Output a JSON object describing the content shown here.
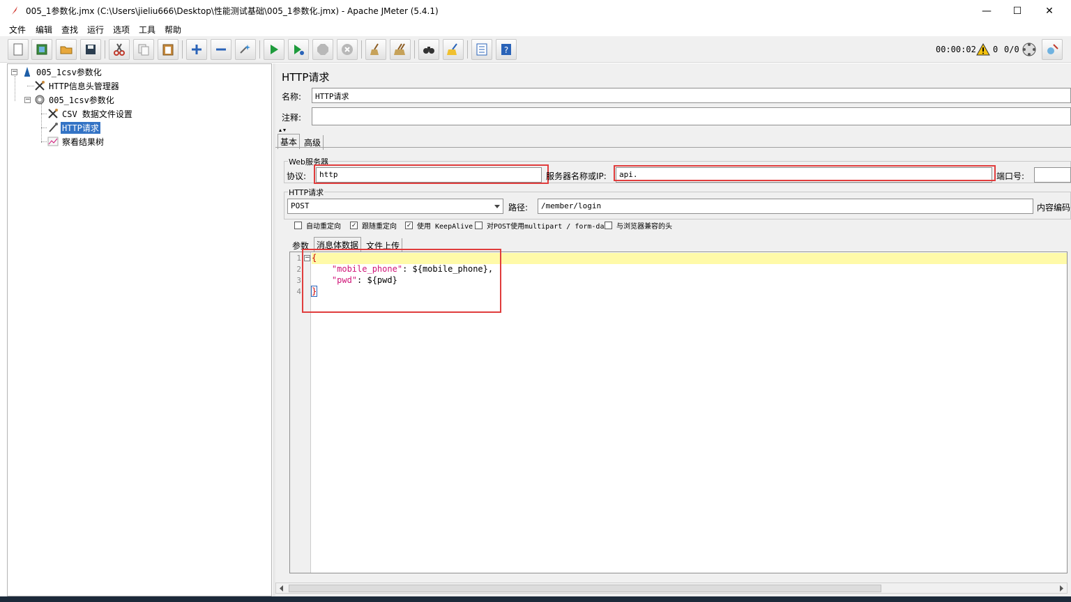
{
  "window": {
    "title": "005_1参数化.jmx (C:\\Users\\jieliu666\\Desktop\\性能测试基础\\005_1参数化.jmx) - Apache JMeter (5.4.1)",
    "minimize": "—",
    "maximize": "☐",
    "close": "✕"
  },
  "menu": [
    "文件",
    "编辑",
    "查找",
    "运行",
    "选项",
    "工具",
    "帮助"
  ],
  "toolbar": {
    "timer": "00:00:02",
    "warnings": "0",
    "threads": "0/0"
  },
  "tree": {
    "root": "005_1csv参数化",
    "header_manager": "HTTP信息头管理器",
    "thread_group": "005_1csv参数化",
    "csv_config": "CSV 数据文件设置",
    "http_request": "HTTP请求",
    "result_tree": "察看结果树"
  },
  "panel": {
    "heading": "HTTP请求",
    "name_label": "名称:",
    "name_value": "HTTP请求",
    "comment_label": "注释:",
    "comment_value": "",
    "tab_basic": "基本",
    "tab_advanced": "高级",
    "web_server_title": "Web服务器",
    "protocol_label": "协议:",
    "protocol_value": "http",
    "server_label": "服务器名称或IP:",
    "server_value": "api.",
    "port_label": "端口号:",
    "port_value": "",
    "http_request_title": "HTTP请求",
    "method_value": "POST",
    "path_label": "路径:",
    "path_value": "/member/login",
    "encoding_label": "内容编码",
    "checkboxes": [
      {
        "label": "自动重定向",
        "checked": false
      },
      {
        "label": "跟随重定向",
        "checked": true
      },
      {
        "label": "使用 KeepAlive",
        "checked": true
      },
      {
        "label": "对POST使用multipart / form-data",
        "checked": false
      },
      {
        "label": "与浏览器兼容的头",
        "checked": false
      }
    ],
    "subtab_params": "参数",
    "subtab_body": "消息体数据",
    "subtab_files": "文件上传"
  },
  "editor": {
    "line_numbers": [
      "1",
      "2",
      "3",
      "4"
    ],
    "line1": "{",
    "line2_key": "\"mobile_phone\"",
    "line2_rest": ": ${mobile_phone},",
    "line3_key": "\"pwd\"",
    "line3_rest": ": ${pwd}",
    "line4": "}"
  },
  "colors": {
    "highlight_line": "#fffaa8",
    "annotation_red": "#e03c3c",
    "selection": "#3373c5"
  }
}
